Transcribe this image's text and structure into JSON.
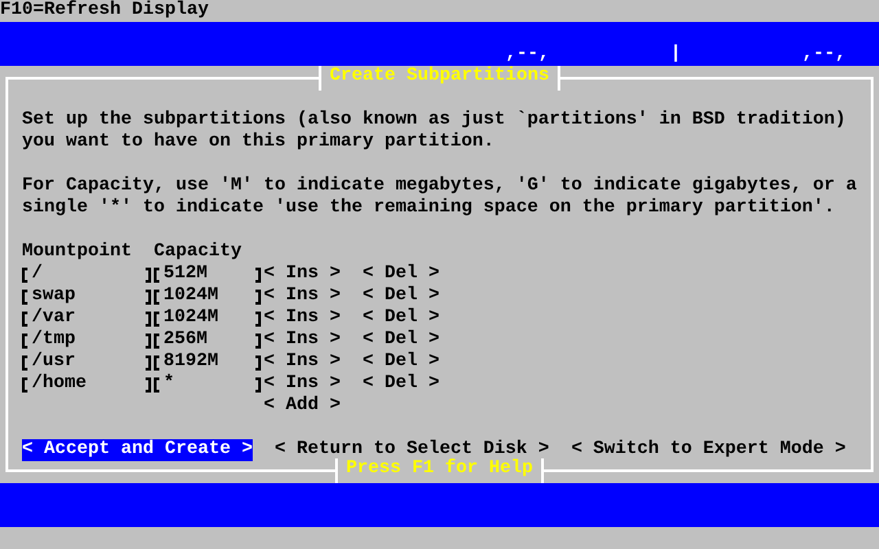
{
  "top_bar": {
    "text": "F10=Refresh Display"
  },
  "header_marks": [
    ",--,",
    "|",
    ",--,"
  ],
  "dialog": {
    "title": "Create Subpartitions",
    "paragraphs": [
      [
        "Set up the subpartitions (also known as just `partitions' in BSD tradition)",
        "you want to have on this primary partition."
      ],
      [
        "For Capacity, use 'M' to indicate megabytes, 'G' to indicate gigabytes, or a",
        "single '*' to indicate 'use the remaining space on the primary partition'."
      ]
    ],
    "columns": [
      "Mountpoint",
      "Capacity"
    ],
    "rows": [
      {
        "mountpoint": "/",
        "capacity": "512M",
        "insert": "< Ins >",
        "delete": "< Del >"
      },
      {
        "mountpoint": "swap",
        "capacity": "1024M",
        "insert": "< Ins >",
        "delete": "< Del >"
      },
      {
        "mountpoint": "/var",
        "capacity": "1024M",
        "insert": "< Ins >",
        "delete": "< Del >"
      },
      {
        "mountpoint": "/tmp",
        "capacity": "256M",
        "insert": "< Ins >",
        "delete": "< Del >"
      },
      {
        "mountpoint": "/usr",
        "capacity": "8192M",
        "insert": "< Ins >",
        "delete": "< Del >"
      },
      {
        "mountpoint": "/home",
        "capacity": "*",
        "insert": "< Ins >",
        "delete": "< Del >"
      }
    ],
    "add_button": "< Add >",
    "buttons": [
      {
        "label": "< Accept and Create >",
        "selected": true
      },
      {
        "label": "< Return to Select Disk >",
        "selected": false
      },
      {
        "label": "< Switch to Expert Mode >",
        "selected": false
      }
    ],
    "help": "Press F1 for Help"
  }
}
